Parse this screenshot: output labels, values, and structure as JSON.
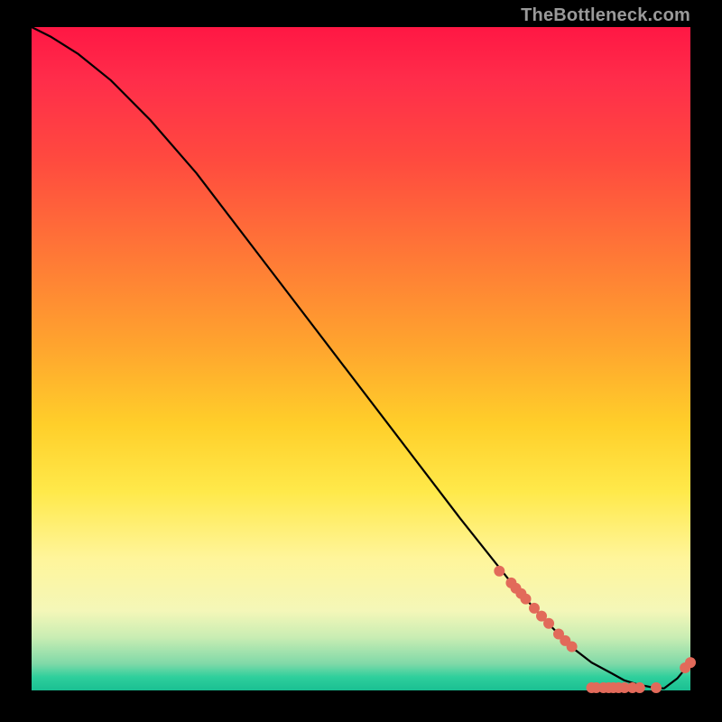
{
  "watermark": "TheBottleneck.com",
  "chart_data": {
    "type": "line",
    "title": "",
    "xlabel": "",
    "ylabel": "",
    "xlim": [
      0,
      100
    ],
    "ylim": [
      0,
      100
    ],
    "grid": false,
    "series": [
      {
        "name": "curve",
        "x": [
          0,
          3,
          7,
          12,
          18,
          25,
          35,
          45,
          55,
          65,
          73,
          78,
          82,
          85,
          88,
          90,
          92,
          94,
          96,
          98,
          100
        ],
        "y": [
          100,
          98.5,
          96,
          92,
          86,
          78,
          65,
          52,
          39,
          26,
          16,
          10.5,
          6.5,
          4.2,
          2.6,
          1.5,
          0.9,
          0.5,
          0.3,
          1.8,
          4.2
        ]
      }
    ],
    "markers": [
      {
        "x": 71,
        "y": 18.0
      },
      {
        "x": 72.8,
        "y": 16.2
      },
      {
        "x": 73.5,
        "y": 15.4
      },
      {
        "x": 74.3,
        "y": 14.6
      },
      {
        "x": 75.0,
        "y": 13.8
      },
      {
        "x": 76.3,
        "y": 12.4
      },
      {
        "x": 77.4,
        "y": 11.2
      },
      {
        "x": 78.5,
        "y": 10.1
      },
      {
        "x": 80.0,
        "y": 8.5
      },
      {
        "x": 81.0,
        "y": 7.5
      },
      {
        "x": 82.0,
        "y": 6.6
      },
      {
        "x": 85.0,
        "y": 0.4
      },
      {
        "x": 85.7,
        "y": 0.4
      },
      {
        "x": 86.8,
        "y": 0.4
      },
      {
        "x": 87.6,
        "y": 0.4
      },
      {
        "x": 88.3,
        "y": 0.4
      },
      {
        "x": 89.1,
        "y": 0.4
      },
      {
        "x": 90.0,
        "y": 0.4
      },
      {
        "x": 91.2,
        "y": 0.4
      },
      {
        "x": 92.3,
        "y": 0.4
      },
      {
        "x": 94.8,
        "y": 0.4
      },
      {
        "x": 99.2,
        "y": 3.4
      },
      {
        "x": 100.0,
        "y": 4.2
      }
    ],
    "colors": {
      "curve": "#000000",
      "marker_fill": "#e26a5a",
      "marker_stroke": "#b94e40"
    }
  }
}
